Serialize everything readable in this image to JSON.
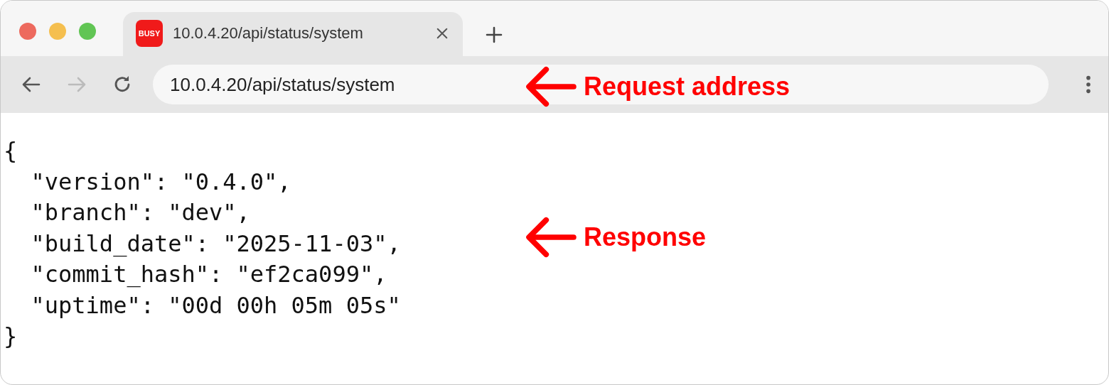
{
  "tab": {
    "favicon": "BUSY",
    "title": "10.0.4.20/api/status/system",
    "selected": true
  },
  "toolbar": {
    "back_disabled": false,
    "forward_disabled": true,
    "address": "10.0.4.20/api/status/system"
  },
  "response_lines": [
    "{",
    "  \"version\": \"0.4.0\",",
    "  \"branch\": \"dev\",",
    "  \"build_date\": \"2025-11-03\",",
    "  \"commit_hash\": \"ef2ca099\",",
    "  \"uptime\": \"00d 00h 05m 05s\"",
    "}"
  ],
  "annotations": [
    {
      "kind": "address",
      "label": "Request address"
    },
    {
      "kind": "response",
      "label": "Response"
    }
  ]
}
